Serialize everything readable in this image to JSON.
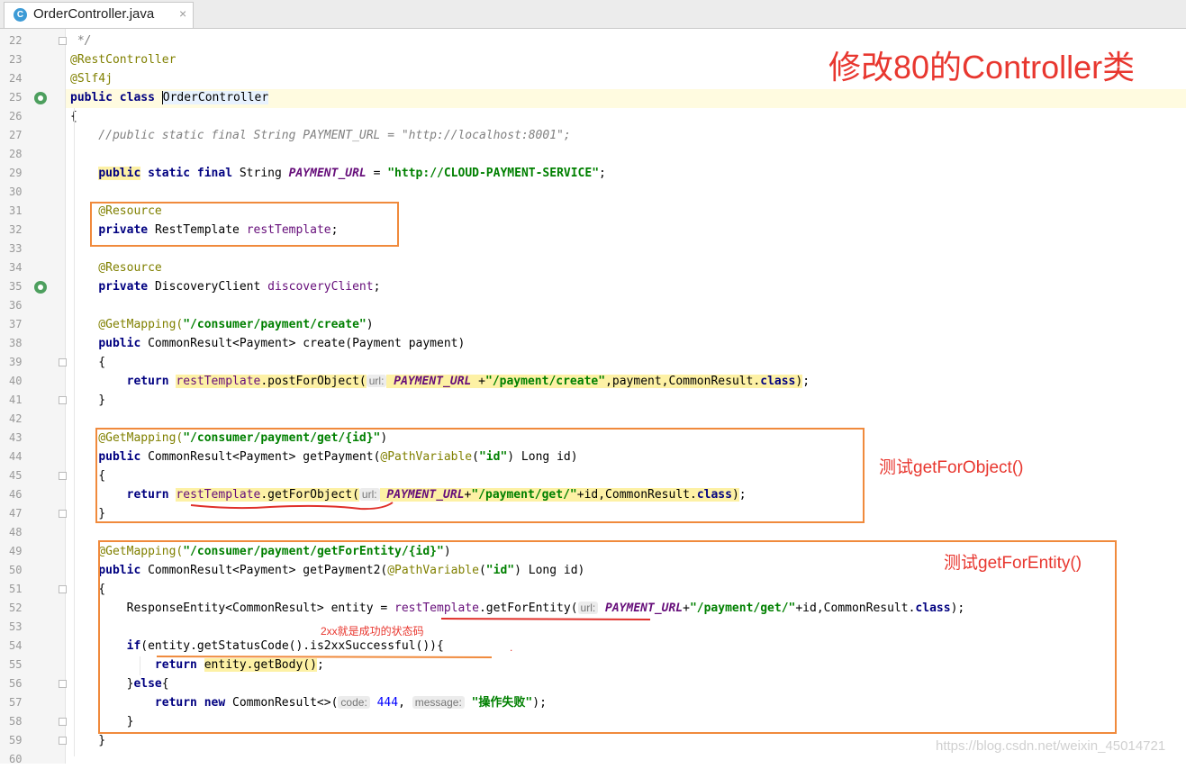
{
  "tab": {
    "title": "OrderController.java",
    "icon_letter": "C",
    "close": "×"
  },
  "annotations": {
    "title": "修改80的Controller类",
    "test_get_for_object": "测试getForObject()",
    "test_get_for_entity": "测试getForEntity()",
    "status_note": "2xx就是成功的状态码"
  },
  "watermark": "https://blog.csdn.net/weixin_45014721",
  "lines": [
    {
      "n": "22",
      "t": [
        {
          "s": " */",
          "c": "cmt"
        }
      ]
    },
    {
      "n": "23",
      "t": [
        {
          "s": "@RestController",
          "c": "ann"
        }
      ]
    },
    {
      "n": "24",
      "t": [
        {
          "s": "@Slf4j",
          "c": "ann"
        }
      ]
    },
    {
      "n": "25",
      "t": [
        {
          "s": "public class ",
          "c": "kw"
        },
        {
          "s": "OrderController",
          "c": "hlbox"
        }
      ]
    },
    {
      "n": "26",
      "t": [
        {
          "s": "{",
          "c": ""
        }
      ]
    },
    {
      "n": "27",
      "t": [
        {
          "s": "    //public static final String PAYMENT_URL = \"http://localhost:8001\";",
          "c": "cmt"
        }
      ]
    },
    {
      "n": "28",
      "t": []
    },
    {
      "n": "29",
      "t": [
        {
          "s": "    ",
          "c": ""
        },
        {
          "s": "public",
          "c": "kw hl"
        },
        {
          "s": " static final ",
          "c": "kw"
        },
        {
          "s": "String ",
          "c": ""
        },
        {
          "s": "PAYMENT_URL",
          "c": "fld"
        },
        {
          "s": " = ",
          "c": ""
        },
        {
          "s": "\"http://CLOUD-PAYMENT-SERVICE\"",
          "c": "str"
        },
        {
          "s": ";",
          "c": ""
        }
      ]
    },
    {
      "n": "30",
      "t": []
    },
    {
      "n": "31",
      "t": [
        {
          "s": "    @Resource",
          "c": "ann"
        }
      ]
    },
    {
      "n": "32",
      "t": [
        {
          "s": "    ",
          "c": ""
        },
        {
          "s": "private ",
          "c": "kw"
        },
        {
          "s": "RestTemplate ",
          "c": ""
        },
        {
          "s": "restTemplate",
          "c": "mfld"
        },
        {
          "s": ";",
          "c": ""
        }
      ]
    },
    {
      "n": "33",
      "t": []
    },
    {
      "n": "34",
      "t": [
        {
          "s": "    @Resource",
          "c": "ann"
        }
      ]
    },
    {
      "n": "35",
      "t": [
        {
          "s": "    ",
          "c": ""
        },
        {
          "s": "private ",
          "c": "kw"
        },
        {
          "s": "DiscoveryClient ",
          "c": ""
        },
        {
          "s": "discoveryClient",
          "c": "mfld"
        },
        {
          "s": ";",
          "c": ""
        }
      ]
    },
    {
      "n": "36",
      "t": []
    },
    {
      "n": "37",
      "t": [
        {
          "s": "    @GetMapping(",
          "c": "ann"
        },
        {
          "s": "\"/consumer/payment/create\"",
          "c": "str"
        },
        {
          "s": ")",
          "c": ""
        }
      ]
    },
    {
      "n": "38",
      "t": [
        {
          "s": "    ",
          "c": ""
        },
        {
          "s": "public ",
          "c": "kw"
        },
        {
          "s": "CommonResult<Payment> create(Payment payment)",
          "c": ""
        }
      ]
    },
    {
      "n": "39",
      "t": [
        {
          "s": "    {",
          "c": ""
        }
      ]
    },
    {
      "n": "40",
      "t": [
        {
          "s": "        ",
          "c": ""
        },
        {
          "s": "return ",
          "c": "kw"
        },
        {
          "s": "restTemplate",
          "c": "mfld hl"
        },
        {
          "s": ".postForObject(",
          "c": "hl"
        },
        {
          "s": "url:",
          "c": "hint"
        },
        {
          "s": " ",
          "c": "hl"
        },
        {
          "s": "PAYMENT_URL",
          "c": "fld hl"
        },
        {
          "s": " +",
          "c": "hl"
        },
        {
          "s": "\"/payment/create\"",
          "c": "str hl"
        },
        {
          "s": ",payment,CommonResult.",
          "c": "hl"
        },
        {
          "s": "class",
          "c": "kw hl"
        },
        {
          "s": ")",
          "c": "hl"
        },
        {
          "s": ";",
          "c": ""
        }
      ]
    },
    {
      "n": "41",
      "t": [
        {
          "s": "    }",
          "c": ""
        }
      ]
    },
    {
      "n": "42",
      "t": []
    },
    {
      "n": "43",
      "t": [
        {
          "s": "    @GetMapping(",
          "c": "ann"
        },
        {
          "s": "\"/consumer/payment/get/{id}\"",
          "c": "str"
        },
        {
          "s": ")",
          "c": ""
        }
      ]
    },
    {
      "n": "44",
      "t": [
        {
          "s": "    ",
          "c": ""
        },
        {
          "s": "public ",
          "c": "kw"
        },
        {
          "s": "CommonResult<Payment> getPayment(",
          "c": ""
        },
        {
          "s": "@PathVariable",
          "c": "ann"
        },
        {
          "s": "(",
          "c": ""
        },
        {
          "s": "\"id\"",
          "c": "str"
        },
        {
          "s": ") Long id)",
          "c": ""
        }
      ]
    },
    {
      "n": "45",
      "t": [
        {
          "s": "    {",
          "c": ""
        }
      ]
    },
    {
      "n": "46",
      "t": [
        {
          "s": "        ",
          "c": ""
        },
        {
          "s": "return ",
          "c": "kw"
        },
        {
          "s": "restTemplate",
          "c": "mfld hl"
        },
        {
          "s": ".getForObject(",
          "c": "hl"
        },
        {
          "s": "url:",
          "c": "hint"
        },
        {
          "s": " ",
          "c": "hl"
        },
        {
          "s": "PAYMENT_URL",
          "c": "fld hl"
        },
        {
          "s": "+",
          "c": "hl"
        },
        {
          "s": "\"/payment/get/\"",
          "c": "str hl"
        },
        {
          "s": "+id,CommonResult.",
          "c": "hl"
        },
        {
          "s": "class",
          "c": "kw hl"
        },
        {
          "s": ")",
          "c": "hl"
        },
        {
          "s": ";",
          "c": ""
        }
      ]
    },
    {
      "n": "47",
      "t": [
        {
          "s": "    }",
          "c": ""
        }
      ]
    },
    {
      "n": "48",
      "t": []
    },
    {
      "n": "49",
      "t": [
        {
          "s": "    @GetMapping(",
          "c": "ann"
        },
        {
          "s": "\"/consumer/payment/getForEntity/{id}\"",
          "c": "str"
        },
        {
          "s": ")",
          "c": ""
        }
      ]
    },
    {
      "n": "50",
      "t": [
        {
          "s": "    ",
          "c": ""
        },
        {
          "s": "public ",
          "c": "kw"
        },
        {
          "s": "CommonResult<Payment> getPayment2(",
          "c": ""
        },
        {
          "s": "@PathVariable",
          "c": "ann"
        },
        {
          "s": "(",
          "c": ""
        },
        {
          "s": "\"id\"",
          "c": "str"
        },
        {
          "s": ") Long id)",
          "c": ""
        }
      ]
    },
    {
      "n": "51",
      "t": [
        {
          "s": "    {",
          "c": ""
        }
      ]
    },
    {
      "n": "52",
      "t": [
        {
          "s": "        ResponseEntity<CommonResult> entity = ",
          "c": ""
        },
        {
          "s": "restTemplate",
          "c": "mfld"
        },
        {
          "s": ".getForEntity(",
          "c": ""
        },
        {
          "s": "url:",
          "c": "hint"
        },
        {
          "s": " ",
          "c": ""
        },
        {
          "s": "PAYMENT_URL",
          "c": "fld"
        },
        {
          "s": "+",
          "c": ""
        },
        {
          "s": "\"/payment/get/\"",
          "c": "str"
        },
        {
          "s": "+id,CommonResult.",
          "c": ""
        },
        {
          "s": "class",
          "c": "kw"
        },
        {
          "s": ");",
          "c": ""
        }
      ]
    },
    {
      "n": "53",
      "t": []
    },
    {
      "n": "54",
      "t": [
        {
          "s": "        ",
          "c": ""
        },
        {
          "s": "if",
          "c": "kw"
        },
        {
          "s": "(entity.getStatusCode().is2xxSuccessful()){",
          "c": ""
        }
      ]
    },
    {
      "n": "55",
      "t": [
        {
          "s": "            ",
          "c": ""
        },
        {
          "s": "return ",
          "c": "kw"
        },
        {
          "s": "entity.getBody()",
          "c": "hl"
        },
        {
          "s": ";",
          "c": ""
        }
      ]
    },
    {
      "n": "56",
      "t": [
        {
          "s": "        }",
          "c": ""
        },
        {
          "s": "else",
          "c": "kw"
        },
        {
          "s": "{",
          "c": ""
        }
      ]
    },
    {
      "n": "57",
      "t": [
        {
          "s": "            ",
          "c": ""
        },
        {
          "s": "return new ",
          "c": "kw"
        },
        {
          "s": "CommonResult<>(",
          "c": ""
        },
        {
          "s": "code:",
          "c": "hint"
        },
        {
          "s": " ",
          "c": ""
        },
        {
          "s": "444",
          "c": "num"
        },
        {
          "s": ", ",
          "c": ""
        },
        {
          "s": "message:",
          "c": "hint"
        },
        {
          "s": " ",
          "c": ""
        },
        {
          "s": "\"操作失败\"",
          "c": "str"
        },
        {
          "s": ");",
          "c": ""
        }
      ]
    },
    {
      "n": "58",
      "t": [
        {
          "s": "        }",
          "c": ""
        }
      ]
    },
    {
      "n": "59",
      "t": [
        {
          "s": "    }",
          "c": ""
        }
      ]
    },
    {
      "n": "60",
      "t": []
    }
  ]
}
